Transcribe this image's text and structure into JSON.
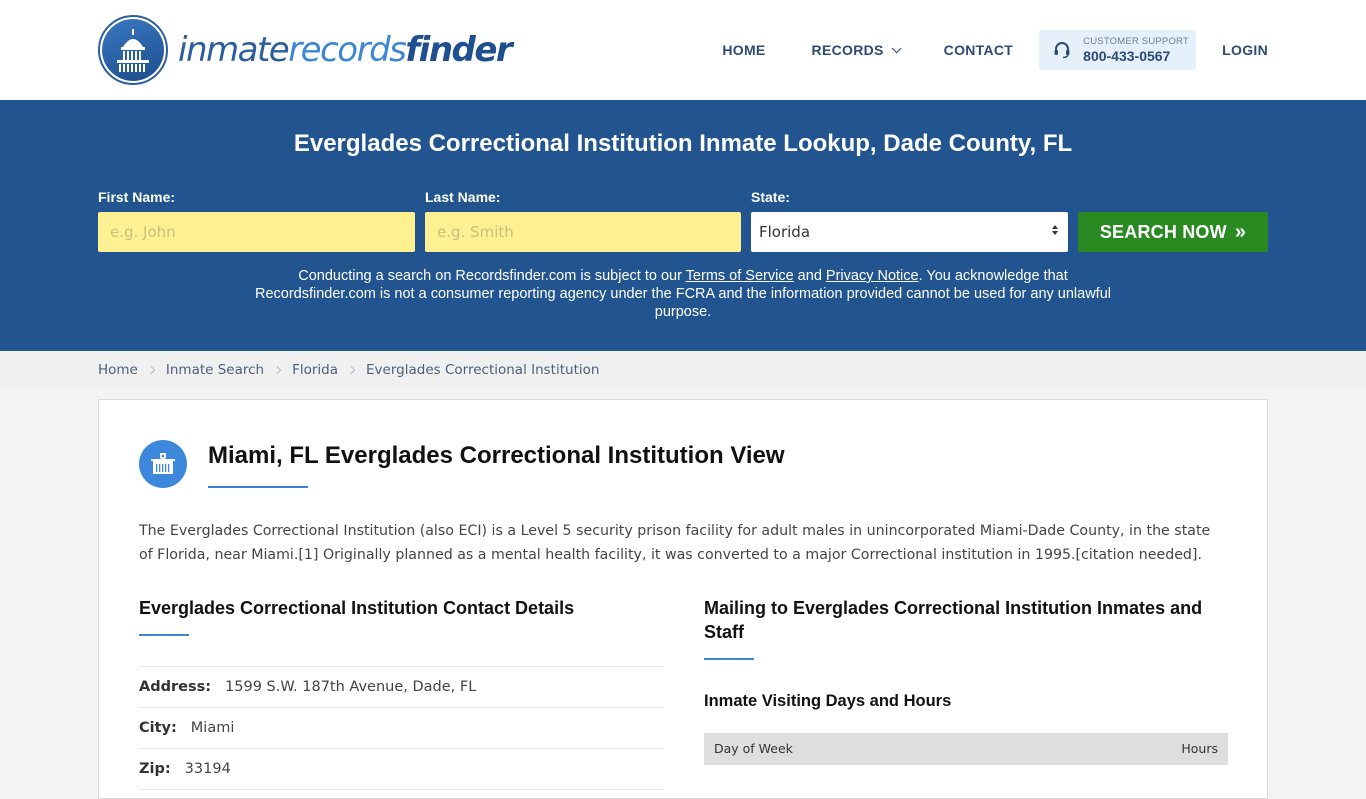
{
  "header": {
    "logo": {
      "part1": "inmate",
      "part2": "records",
      "part3": "finder"
    },
    "nav": {
      "home": "HOME",
      "records": "RECORDS",
      "contact": "CONTACT",
      "support_label": "CUSTOMER SUPPORT",
      "support_phone": "800-433-0567",
      "login": "LOGIN"
    }
  },
  "banner": {
    "title": "Everglades Correctional Institution Inmate Lookup, Dade County, FL",
    "first_name": {
      "label": "First Name:",
      "placeholder": "e.g. John",
      "value": ""
    },
    "last_name": {
      "label": "Last Name:",
      "placeholder": "e.g. Smith",
      "value": ""
    },
    "state": {
      "label": "State:",
      "selected": "Florida"
    },
    "search_button": "SEARCH NOW",
    "disclaimer": {
      "part1": "Conducting a search on Recordsfinder.com is subject to our ",
      "terms_link": "Terms of Service",
      "part2": " and ",
      "privacy_link": "Privacy Notice",
      "part3": ". You acknowledge that Recordsfinder.com is not a consumer reporting agency under the FCRA and the information provided cannot be used for any unlawful purpose."
    }
  },
  "breadcrumb": [
    "Home",
    "Inmate Search",
    "Florida",
    "Everglades Correctional Institution"
  ],
  "main": {
    "title": "Miami, FL Everglades Correctional Institution View",
    "intro": "The Everglades Correctional Institution (also ECI) is a Level 5 security prison facility for adult males in unincorporated Miami-Dade County, in the state of Florida, near Miami.[1] Originally planned as a mental health facility, it was converted to a major Correctional institution in 1995.[citation needed].",
    "contact": {
      "title": "Everglades Correctional Institution Contact Details",
      "rows": [
        {
          "key": "Address:",
          "value": "1599 S.W. 187th Avenue, Dade, FL"
        },
        {
          "key": "City:",
          "value": "Miami"
        },
        {
          "key": "Zip:",
          "value": "33194"
        }
      ]
    },
    "mailing": {
      "title": "Mailing to Everglades Correctional Institution Inmates and Staff",
      "visiting_title": "Inmate Visiting Days and Hours",
      "table_headers": [
        "Day of Week",
        "Hours"
      ]
    }
  }
}
